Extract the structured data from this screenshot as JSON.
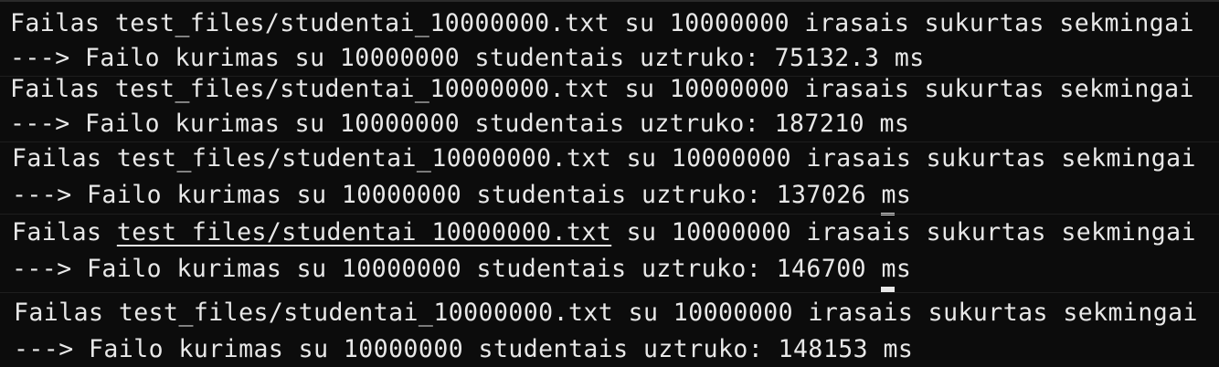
{
  "terminal": {
    "lines": [
      {
        "prefix": "Failas ",
        "path": "test_files/studentai_10000000.txt",
        "suffix": " su 10000000 irasais sukurtas sekmingai"
      },
      {
        "prefix": "---> Failo kurimas su 10000000 studentais uztruko: 75132.3 ",
        "unit": "ms"
      },
      {
        "prefix": "Failas ",
        "path": "test_files/studentai_10000000.txt",
        "suffix": " su 10000000 irasais sukurtas sekmingai"
      },
      {
        "prefix": "---> Failo kurimas su 10000000 studentais uztruko: 187210 ",
        "unit": "ms"
      },
      {
        "prefix": "Failas ",
        "path": "test_files/studentai_10000000.txt",
        "suffix": " su 10000000 irasais sukurtas sekmingai"
      },
      {
        "prefix": "---> Failo kurimas su 10000000 studentais uztruko: 137026 ",
        "unit": "ms"
      },
      {
        "prefix": "Failas ",
        "path": "test_files/studentai_10000000.txt",
        "suffix": " su 10000000 irasais sukurtas sekmingai"
      },
      {
        "prefix": "---> Failo kurimas su 10000000 studentais uztruko: 146700 ",
        "unit": "ms"
      },
      {
        "prefix": "Failas ",
        "path": "test_files/studentai_10000000.txt",
        "suffix": " su 10000000 irasais sukurtas sekmingai"
      },
      {
        "prefix": "---> Failo kurimas su 10000000 studentais uztruko: 148153 ",
        "unit": "ms"
      }
    ]
  },
  "colors": {
    "background": "#0c0c0c",
    "text": "#e8e8e8"
  }
}
